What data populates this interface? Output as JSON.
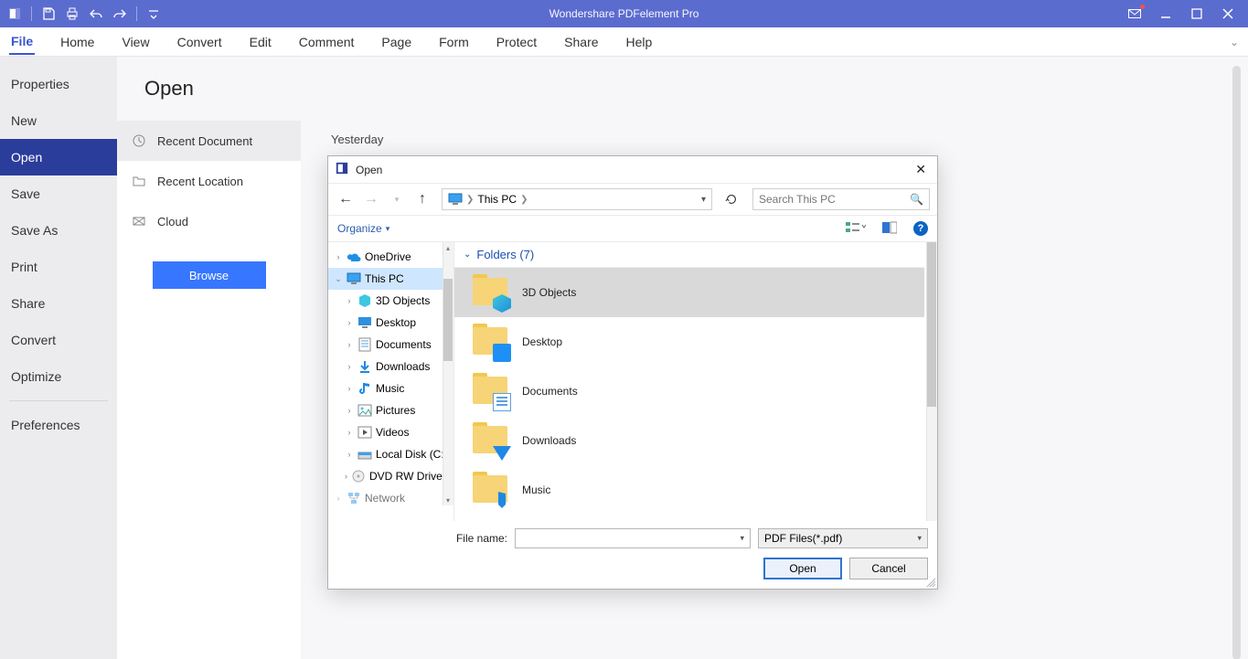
{
  "app": {
    "title": "Wondershare PDFelement Pro"
  },
  "ribbon": {
    "tabs": [
      "File",
      "Home",
      "View",
      "Convert",
      "Edit",
      "Comment",
      "Page",
      "Form",
      "Protect",
      "Share",
      "Help"
    ],
    "active_index": 0
  },
  "sidebar1": {
    "items": [
      "Properties",
      "New",
      "Open",
      "Save",
      "Save As",
      "Print",
      "Share",
      "Convert",
      "Optimize"
    ],
    "bottom_items": [
      "Preferences"
    ],
    "active_index": 2
  },
  "page": {
    "title": "Open"
  },
  "sidebar2": {
    "items": [
      {
        "label": "Recent Document",
        "icon": "clock"
      },
      {
        "label": "Recent Location",
        "icon": "folder"
      },
      {
        "label": "Cloud",
        "icon": "cloud"
      }
    ],
    "active_index": 0,
    "browse_label": "Browse"
  },
  "main": {
    "section_label": "Yesterday"
  },
  "dialog": {
    "title": "Open",
    "path": {
      "root": "This PC"
    },
    "search_placeholder": "Search This PC",
    "organize_label": "Organize",
    "folders_header": "Folders (7)",
    "tree": [
      {
        "label": "OneDrive",
        "depth": 1,
        "icon": "cloud-blue",
        "expand": "collapsed"
      },
      {
        "label": "This PC",
        "depth": 1,
        "icon": "pc",
        "expand": "expanded",
        "selected": true
      },
      {
        "label": "3D Objects",
        "depth": 2,
        "icon": "cube",
        "expand": "collapsed"
      },
      {
        "label": "Desktop",
        "depth": 2,
        "icon": "desktop",
        "expand": "collapsed"
      },
      {
        "label": "Documents",
        "depth": 2,
        "icon": "doc",
        "expand": "collapsed"
      },
      {
        "label": "Downloads",
        "depth": 2,
        "icon": "download",
        "expand": "collapsed"
      },
      {
        "label": "Music",
        "depth": 2,
        "icon": "music",
        "expand": "collapsed"
      },
      {
        "label": "Pictures",
        "depth": 2,
        "icon": "picture",
        "expand": "collapsed"
      },
      {
        "label": "Videos",
        "depth": 2,
        "icon": "video",
        "expand": "collapsed"
      },
      {
        "label": "Local Disk (C:)",
        "depth": 2,
        "icon": "disk",
        "expand": "collapsed"
      },
      {
        "label": "DVD RW Drive (D:)",
        "depth": 2,
        "icon": "dvd",
        "expand": "collapsed"
      },
      {
        "label": "Network",
        "depth": 1,
        "icon": "network",
        "expand": "collapsed",
        "cut": true
      }
    ],
    "folders": [
      {
        "label": "3D Objects",
        "overlay": "cube",
        "selected": true
      },
      {
        "label": "Desktop",
        "overlay": "monitor"
      },
      {
        "label": "Documents",
        "overlay": "doc"
      },
      {
        "label": "Downloads",
        "overlay": "arrow-down"
      },
      {
        "label": "Music",
        "overlay": "note"
      }
    ],
    "file_name_label": "File name:",
    "file_type": "PDF Files(*.pdf)",
    "open_label": "Open",
    "cancel_label": "Cancel"
  }
}
